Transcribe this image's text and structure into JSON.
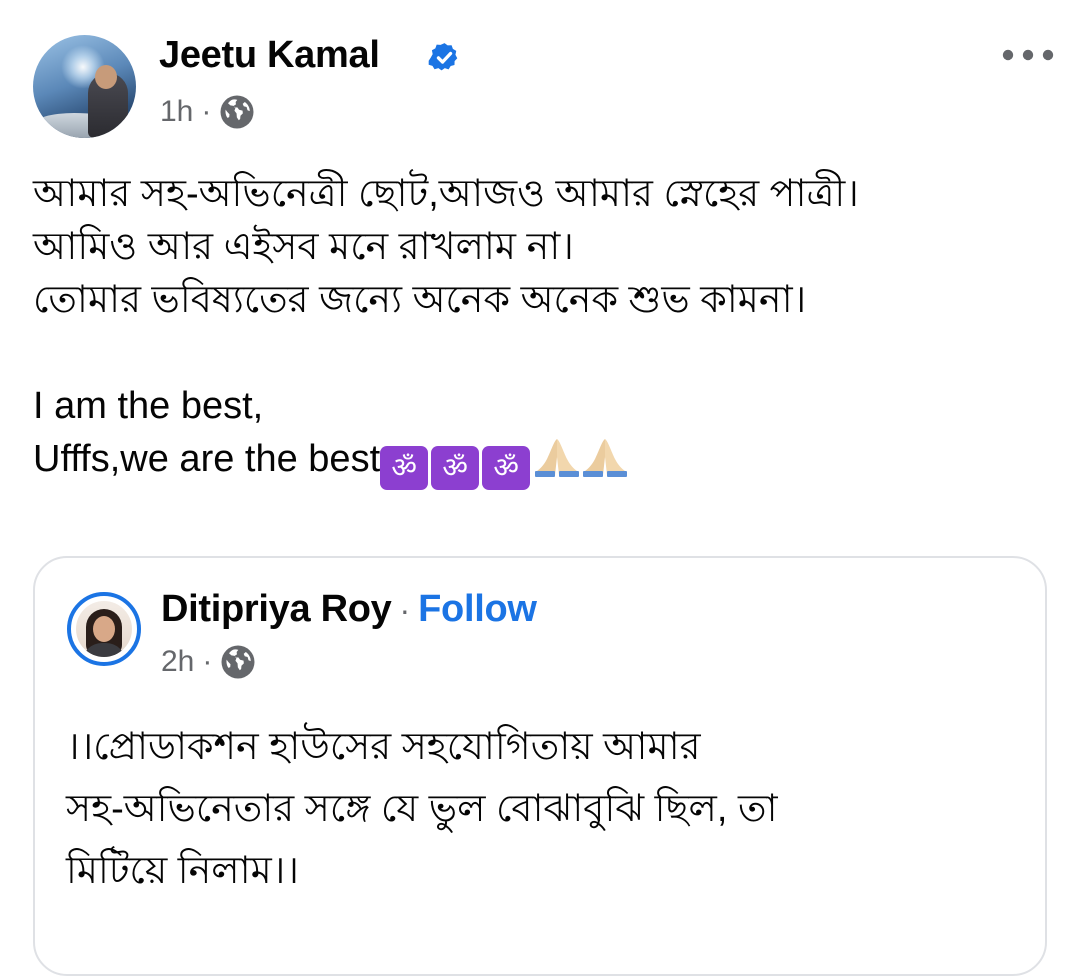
{
  "post": {
    "author": "Jeetu Kamal",
    "time": "1h",
    "separator": "·",
    "lines": [
      "আমার সহ-অভিনেত্রী ছোট,আজও আমার স্নেহের পাত্রী।",
      "আমিও আর এইসব মনে রাখলাম না।",
      "তোমার ভবিষ্যতের জন্যে অনেক অনেক শুভ কামনা।"
    ],
    "english_line_1": "I am the best,",
    "english_line_2": "Ufffs,we are the best",
    "emoji": [
      "om",
      "om",
      "om",
      "folded-hands",
      "folded-hands"
    ],
    "om_glyph": "ॐ"
  },
  "shared": {
    "author": "Ditipriya Roy",
    "separator": "·",
    "follow_label": "Follow",
    "time": "2h",
    "lines": [
      "।।প্রোডাকশন হাউসের সহযোগিতায় আমার",
      "সহ-অভিনেতার সঙ্গে যে ভুল বোঝাবুঝি ছিল, তা",
      "মিটিয়ে নিলাম।।"
    ]
  },
  "colors": {
    "verified": "#1b74e4",
    "follow": "#1b74e4",
    "meta_text": "#65676b",
    "om_badge": "#8c3fd0"
  },
  "icons": {
    "verified": "verified-badge-icon",
    "privacy": "globe-icon",
    "menu": "more-options-icon"
  }
}
